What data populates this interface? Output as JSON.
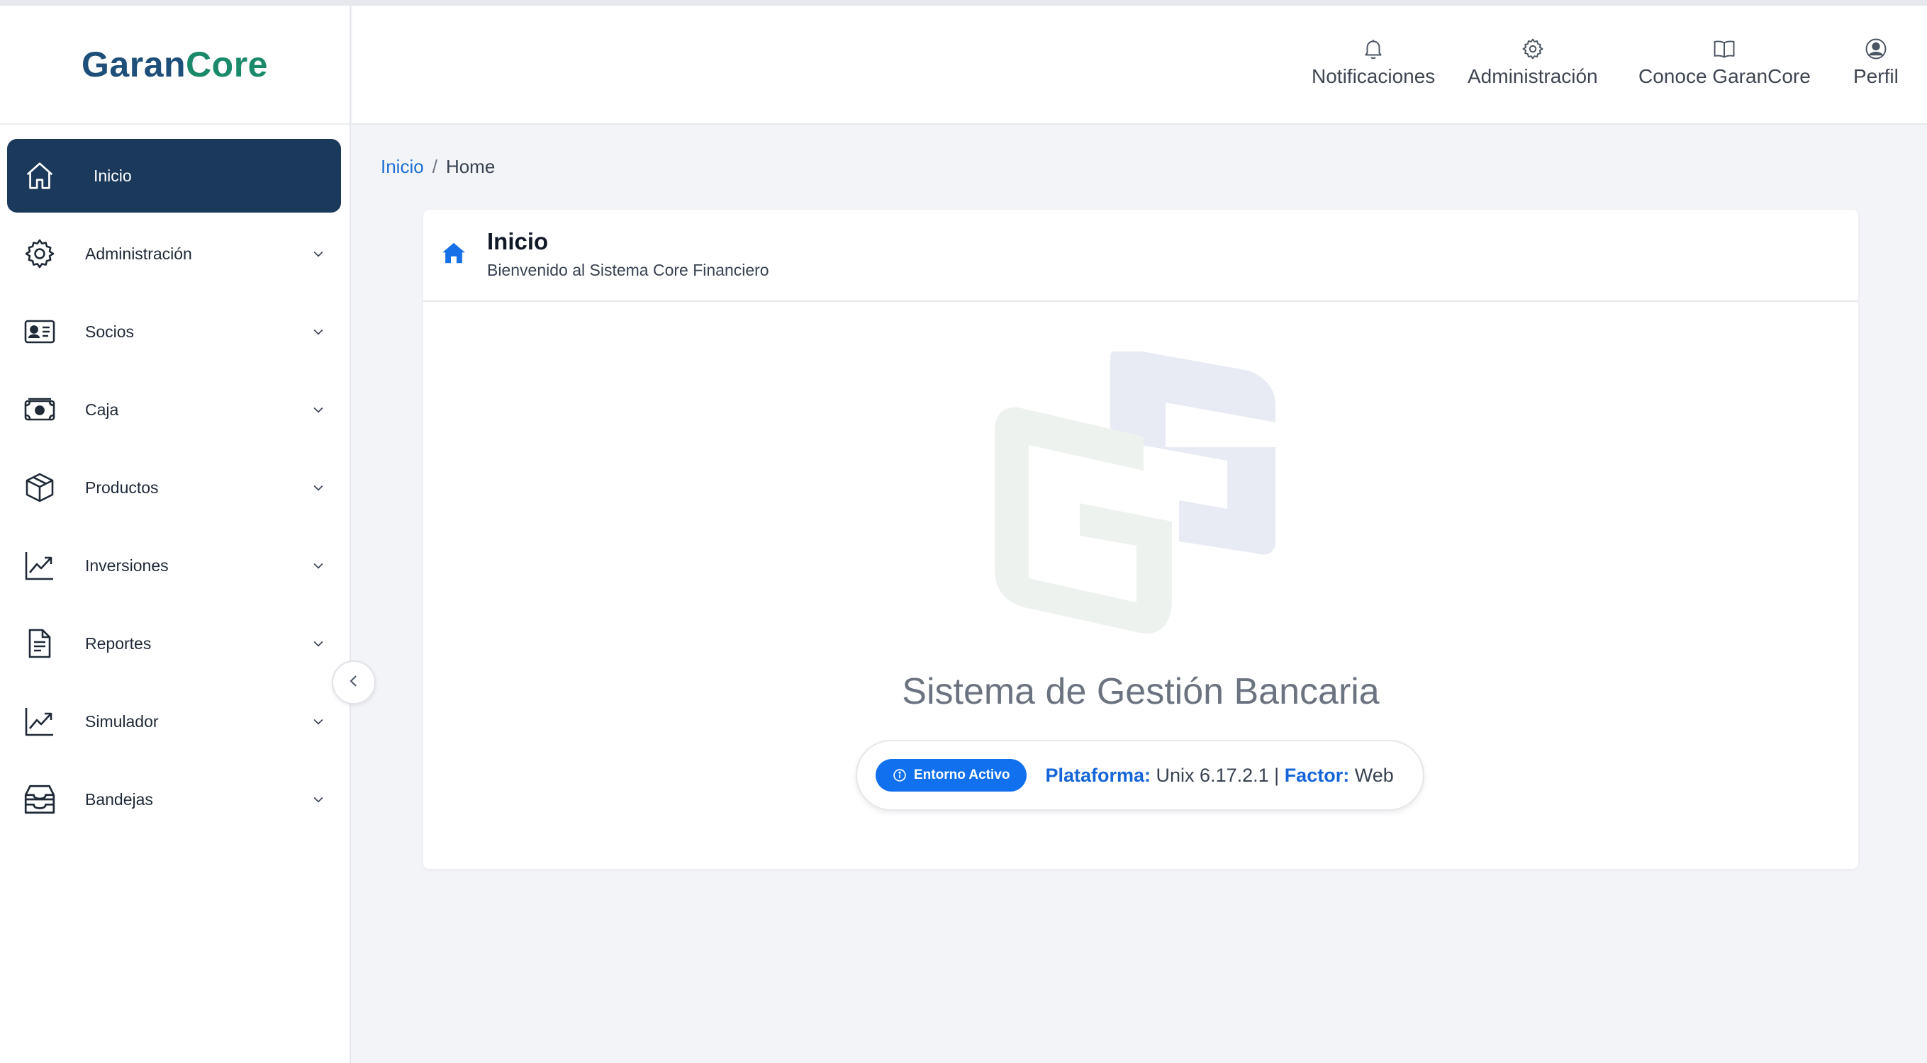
{
  "brand": {
    "part1": "Garan",
    "part2": "Core"
  },
  "header_nav": [
    {
      "label": "Notificaciones",
      "icon": "bell-icon"
    },
    {
      "label": "Administración",
      "icon": "gear-icon"
    },
    {
      "label": "Conoce GaranCore",
      "icon": "book-icon"
    },
    {
      "label": "Perfil",
      "icon": "user-circle-icon"
    }
  ],
  "sidebar": {
    "items": [
      {
        "label": "Inicio",
        "icon": "home-icon",
        "active": true
      },
      {
        "label": "Administración",
        "icon": "gear-icon"
      },
      {
        "label": "Socios",
        "icon": "id-card-icon"
      },
      {
        "label": "Caja",
        "icon": "cash-icon"
      },
      {
        "label": "Productos",
        "icon": "box-icon"
      },
      {
        "label": "Inversiones",
        "icon": "chart-line-icon"
      },
      {
        "label": "Reportes",
        "icon": "document-icon"
      },
      {
        "label": "Simulador",
        "icon": "chart-line-icon"
      },
      {
        "label": "Bandejas",
        "icon": "inbox-icon"
      }
    ]
  },
  "breadcrumb": {
    "link": "Inicio",
    "separator": "/",
    "current": "Home"
  },
  "card": {
    "title": "Inicio",
    "subtitle": "Bienvenido al Sistema Core Financiero",
    "system_title": "Sistema de Gestión Bancaria",
    "env_badge": "Entorno Activo",
    "platform_label": "Plataforma:",
    "platform_value": "Unix 6.17.2.1",
    "divider": "|",
    "factor_label": "Factor:",
    "factor_value": "Web"
  },
  "colors": {
    "sidebar_active": "#1b3a5b",
    "link": "#1f6fd6",
    "badge": "#1170ee",
    "brand_blue": "#1d4f7a",
    "brand_green": "#1a8a6a"
  }
}
